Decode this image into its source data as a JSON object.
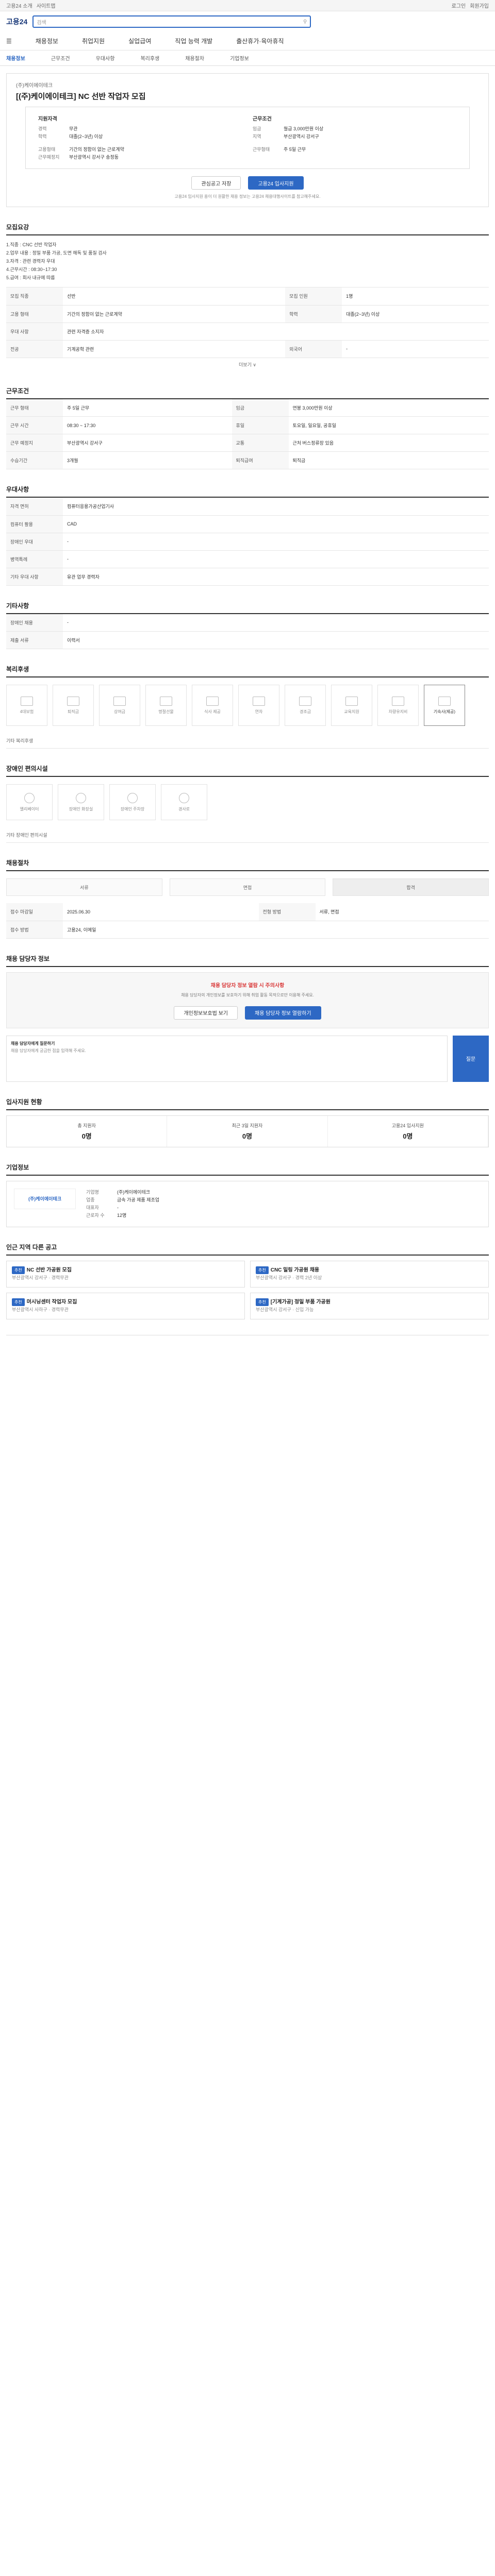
{
  "top": {
    "links": [
      "고용24 소개",
      "사이트맵",
      "로그인",
      "회원가입"
    ]
  },
  "header": {
    "logo": "고용24",
    "search_placeholder": "검색"
  },
  "nav": {
    "menu": "☰",
    "items": [
      "채용정보",
      "취업지원",
      "실업급여",
      "직업 능력 개발",
      "출산휴가·육아휴직"
    ]
  },
  "subtabs": [
    "채용정보",
    "근무조건",
    "우대사항",
    "복리후생",
    "채용절차",
    "기업정보"
  ],
  "job": {
    "company": "(주)케이에이테크",
    "title": "[(주)케이에이테크] NC 선반 작업자 모집",
    "left_title": "지원자격",
    "left": [
      {
        "k": "경력",
        "v": "무관"
      },
      {
        "k": "학력",
        "v": "대졸(2~3년) 이상"
      },
      {
        "k": "",
        "v": ""
      },
      {
        "k": "고용형태",
        "v": "기간의 정함이 없는 근로계약"
      },
      {
        "k": "근무예정지",
        "v": "부산광역시 강서구 송정동"
      }
    ],
    "right_title": "근무조건",
    "right": [
      {
        "k": "임금",
        "v": "월급 3,000만원 이상"
      },
      {
        "k": "지역",
        "v": "부산광역시 강서구"
      },
      {
        "k": "",
        "v": ""
      },
      {
        "k": "근무형태",
        "v": "주 5일 근무"
      }
    ],
    "btn_scrap": "관심공고 저장",
    "btn_apply": "고용24 입사지원",
    "notice": "고용24 입사지원 용이 더 원활한 채용 정보는 고용24 채용대행사이트를 참고해주세요."
  },
  "sections": {
    "recruit": "모집요강",
    "recruit_desc": [
      "1.직종 : CNC 선반 작업자",
      "2.업무 내용 : 정밀 부품 가공, 도면 해독 및 품질 검사",
      "3.자격 : 관련 경력자 우대",
      "4.근무시간 : 08:30~17:30",
      "5.급여 : 회사 내규에 따름"
    ],
    "recruit_rows": [
      {
        "k": "모집 직종",
        "v": "선반"
      },
      {
        "k": "모집 인원",
        "v": "1명"
      },
      {
        "k": "고용 형태",
        "v": "기간의 정함이 없는 근로계약"
      },
      {
        "k": "학력",
        "v": "대졸(2~3년) 이상"
      },
      {
        "k": "우대 사항",
        "v": "관련 자격증 소지자"
      },
      {
        "k": "전공",
        "v": "기계공학 관련"
      },
      {
        "k": "외국어",
        "v": "-"
      }
    ],
    "more": "더보기 ∨",
    "work": "근무조건",
    "work_rows": [
      {
        "k": "근무 형태",
        "v": "주 5일 근무"
      },
      {
        "k": "임금",
        "v": "연봉 3,000만원 이상"
      },
      {
        "k": "근무 시간",
        "v": "08:30 ~ 17:30"
      },
      {
        "k": "휴일",
        "v": "토요일, 일요일, 공휴일"
      },
      {
        "k": "근무 예정지",
        "v": "부산광역시 강서구"
      },
      {
        "k": "교통",
        "v": "근처 버스정류장 있음"
      },
      {
        "k": "수습기간",
        "v": "3개월"
      },
      {
        "k": "퇴직급여",
        "v": "퇴직금"
      }
    ],
    "prefer": "우대사항",
    "prefer_rows": [
      {
        "k": "자격 면허",
        "v": "컴퓨터응용가공산업기사"
      },
      {
        "k": "컴퓨터 활용",
        "v": "CAD"
      },
      {
        "k": "장애인 우대",
        "v": "-"
      },
      {
        "k": "병역특례",
        "v": "-"
      },
      {
        "k": "기타 우대 사항",
        "v": "유관 업무 경력자"
      }
    ],
    "etc": "기타사항",
    "etc_rows": [
      {
        "k": "장애인 채용",
        "v": "-"
      },
      {
        "k": "제출 서류",
        "v": "이력서"
      }
    ],
    "benefit": "복리후생",
    "benefits": [
      "4대보험",
      "퇴직금",
      "상여금",
      "명절선물",
      "식사 제공",
      "연차",
      "경조금",
      "교육지원",
      "차량유지비",
      "기숙사(제공)"
    ],
    "benefit_note": "기타 복리후생",
    "welfare": "장애인 편의시설",
    "welfare_items": [
      "엘리베이터",
      "장애인 화장실",
      "장애인 주차장",
      "경사로"
    ],
    "welfare_note": "기타 장애인 편의시설",
    "process": "채용절차",
    "proc_rows": [
      {
        "k": "접수 마감일",
        "v": "2025.06.30"
      },
      {
        "k": "전형 방법",
        "v": "서류, 면접"
      },
      {
        "k": "접수 방법",
        "v": "고용24, 이메일"
      }
    ],
    "steps": [
      "서류",
      "면접",
      "합격"
    ],
    "apply_title": "채용 담당자 정보",
    "apply_hl": "채용 담당자 정보 열람 시 주의사항",
    "apply_note": "채용 담당자의 개인정보를 보호하기 위해 취업 활동 목적으로만 이용해 주세요.",
    "apply_btn1": "개인정보보호법 보기",
    "apply_btn2": "채용 담당자 정보 열람하기",
    "question_title": "채용 담당자에게 질문하기",
    "question_placeholder": "채용 담당자에게 궁금한 점을 입력해 주세요.",
    "question_btn": "질문",
    "stat_title": "입사지원 현황",
    "stats": [
      {
        "k": "총 지원자",
        "v": "0명"
      },
      {
        "k": "최근 3일 지원자",
        "v": "0명"
      },
      {
        "k": "고용24 입사지원",
        "v": "0명"
      }
    ],
    "company_title": "기업정보",
    "company_logo": "(주)케이에이테크",
    "company_rows": [
      {
        "k": "기업명",
        "v": "(주)케이에이테크"
      },
      {
        "k": "업종",
        "v": "금속 가공 제품 제조업"
      },
      {
        "k": "대표자",
        "v": "-"
      },
      {
        "k": "근로자 수",
        "v": "12명"
      }
    ],
    "related_title": "인근 지역 다른 공고",
    "related": [
      {
        "badge": "추천",
        "ttl": "NC 선반 가공원 모집",
        "sub": "부산광역시 강서구 · 경력무관"
      },
      {
        "badge": "추천",
        "ttl": "CNC 밀링 가공원 채용",
        "sub": "부산광역시 강서구 · 경력 2년 이상"
      },
      {
        "badge": "추천",
        "ttl": "머시닝센터 작업자 모집",
        "sub": "부산광역시 사하구 · 경력무관"
      },
      {
        "badge": "추천",
        "ttl": "[기계가공] 정밀 부품 가공원",
        "sub": "부산광역시 강서구 · 신입 가능"
      }
    ]
  }
}
